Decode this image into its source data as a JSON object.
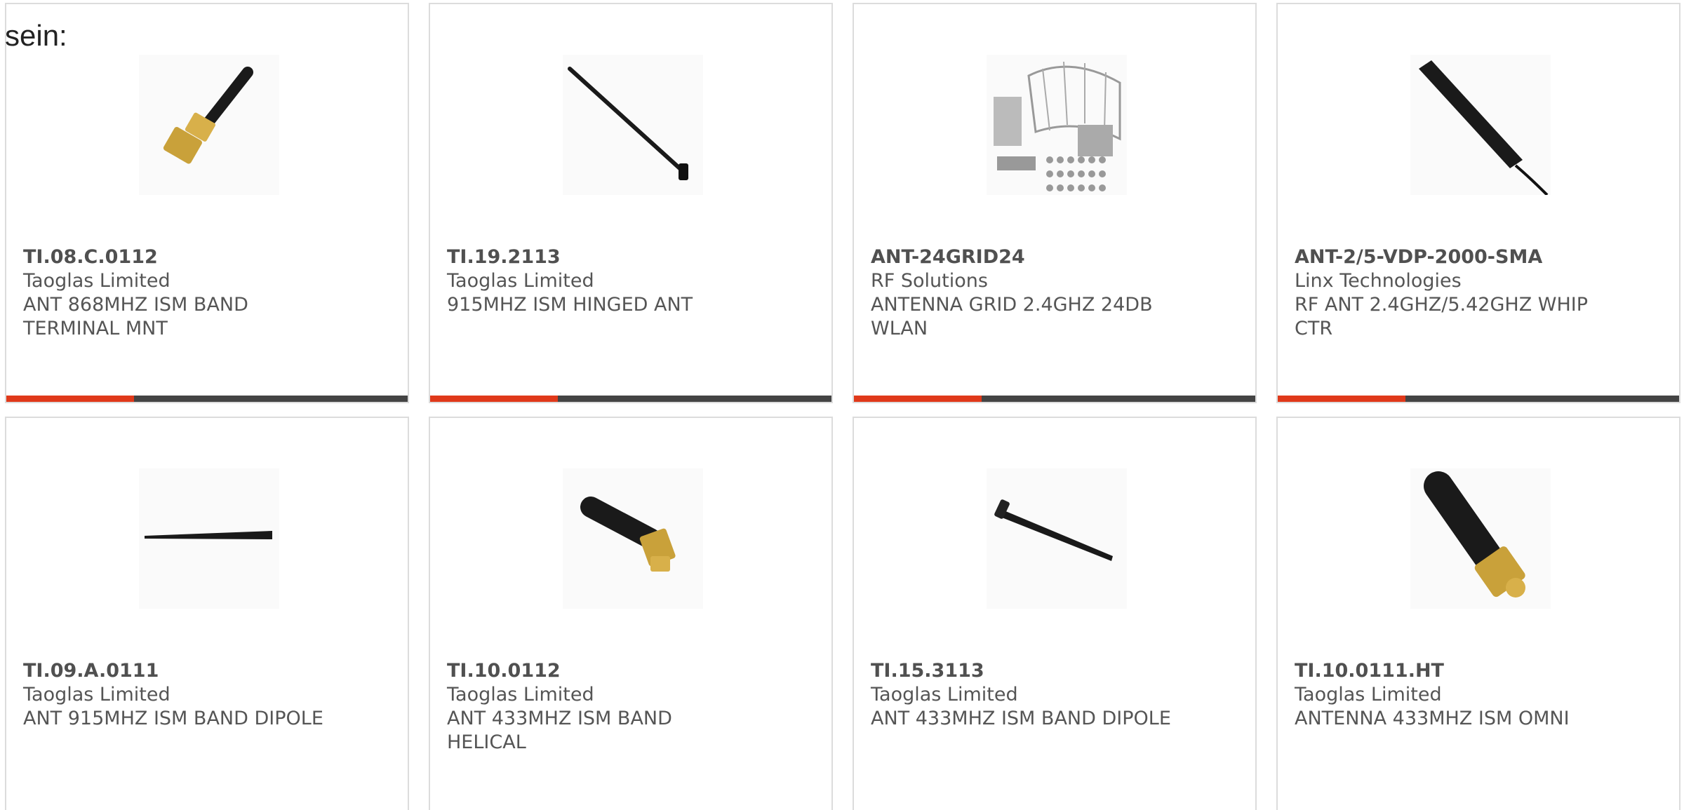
{
  "intro_text": "sein:",
  "accent_color": "#e0391a",
  "bar_color": "#444444",
  "products": [
    {
      "part_number": "TI.08.C.0112",
      "manufacturer": "Taoglas Limited",
      "description": "ANT 868MHZ ISM BAND TERMINAL MNT",
      "image_icon": "right-angle-antenna-icon"
    },
    {
      "part_number": "TI.19.2113",
      "manufacturer": "Taoglas Limited",
      "description": "915MHZ ISM HINGED ANT",
      "image_icon": "hinged-whip-antenna-icon"
    },
    {
      "part_number": "ANT-24GRID24",
      "manufacturer": "RF Solutions",
      "description": "ANTENNA GRID 2.4GHZ 24DB WLAN",
      "image_icon": "grid-antenna-kit-icon"
    },
    {
      "part_number": "ANT-2/5-VDP-2000-SMA",
      "manufacturer": "Linx Technologies",
      "description": "RF ANT 2.4GHZ/5.42GHZ WHIP CTR",
      "image_icon": "flat-whip-antenna-icon"
    },
    {
      "part_number": "TI.09.A.0111",
      "manufacturer": "Taoglas Limited",
      "description": "ANT 915MHZ ISM BAND DIPOLE",
      "image_icon": "dipole-antenna-icon"
    },
    {
      "part_number": "TI.10.0112",
      "manufacturer": "Taoglas Limited",
      "description": "ANT 433MHZ ISM BAND HELICAL",
      "image_icon": "helical-antenna-icon"
    },
    {
      "part_number": "TI.15.3113",
      "manufacturer": "Taoglas Limited",
      "description": "ANT 433MHZ ISM BAND DIPOLE",
      "image_icon": "dipole-whip-antenna-icon"
    },
    {
      "part_number": "TI.10.0111.HT",
      "manufacturer": "Taoglas Limited",
      "description": "ANTENNA 433MHZ ISM OMNI",
      "image_icon": "omni-stubby-antenna-icon"
    }
  ]
}
